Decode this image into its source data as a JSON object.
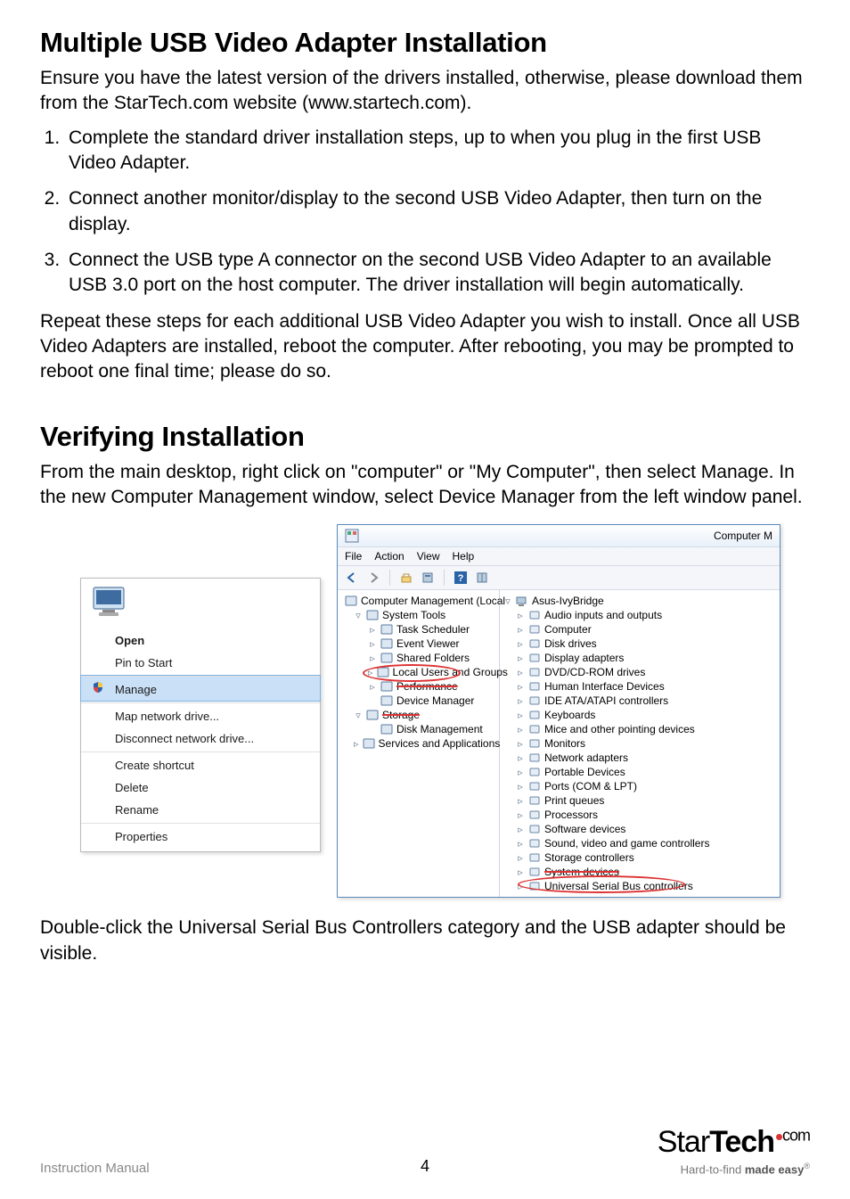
{
  "title1": "Multiple USB Video Adapter Installation",
  "intro1": "Ensure you have the latest version of the drivers installed, otherwise, please download them from the StarTech.com website (www.startech.com).",
  "steps": [
    "Complete the standard driver installation steps, up to when you plug in the first USB Video Adapter.",
    "Connect another monitor/display to the second USB Video Adapter, then turn on the display.",
    "Connect the USB type A connector on the second USB Video Adapter to an available USB 3.0 port on the host computer. The driver installation will begin automatically."
  ],
  "after_steps": "Repeat these steps for each additional USB Video Adapter you wish to install. Once all USB Video Adapters are installed, reboot the computer. After rebooting, you may be prompted to reboot one final time; please do so.",
  "title2": "Verifying Installation",
  "intro2": "From the main desktop, right click on \"computer\" or \"My Computer\", then select Manage. In the new Computer Management window, select Device Manager from the left window panel.",
  "context_menu": {
    "items": [
      {
        "label": "Open",
        "bold": true
      },
      {
        "label": "Pin to Start"
      },
      {
        "label": "Manage",
        "hover": true,
        "shield": true,
        "divider": true
      },
      {
        "label": "Map network drive...",
        "divider": true
      },
      {
        "label": "Disconnect network drive..."
      },
      {
        "label": "Create shortcut",
        "divider": true
      },
      {
        "label": "Delete"
      },
      {
        "label": "Rename"
      },
      {
        "label": "Properties",
        "divider": true
      }
    ]
  },
  "cm": {
    "title_right": "Computer M",
    "menu": [
      "File",
      "Action",
      "View",
      "Help"
    ],
    "left_tree": [
      {
        "label": "Computer Management (Local",
        "icon": "app",
        "indent": 0,
        "tw": ""
      },
      {
        "label": "System Tools",
        "icon": "wrench",
        "indent": 1,
        "tw": "▿"
      },
      {
        "label": "Task Scheduler",
        "icon": "clock",
        "indent": 2,
        "tw": "▹"
      },
      {
        "label": "Event Viewer",
        "icon": "event",
        "indent": 2,
        "tw": "▹"
      },
      {
        "label": "Shared Folders",
        "icon": "folder",
        "indent": 2,
        "tw": "▹"
      },
      {
        "label": "Local Users and Groups",
        "icon": "users",
        "indent": 2,
        "tw": "▹"
      },
      {
        "label": "Performance",
        "icon": "perf",
        "indent": 2,
        "tw": "▹",
        "strike": true
      },
      {
        "label": "Device Manager",
        "icon": "device",
        "indent": 2,
        "tw": "",
        "circle": true
      },
      {
        "label": "Storage",
        "icon": "storage",
        "indent": 1,
        "tw": "▿",
        "strike": true
      },
      {
        "label": "Disk Management",
        "icon": "disk",
        "indent": 2,
        "tw": ""
      },
      {
        "label": "Services and Applications",
        "icon": "services",
        "indent": 1,
        "tw": "▹"
      }
    ],
    "right_tree_root": "Asus-IvyBridge",
    "right_tree": [
      "Audio inputs and outputs",
      "Computer",
      "Disk drives",
      "Display adapters",
      "DVD/CD-ROM drives",
      "Human Interface Devices",
      "IDE ATA/ATAPI controllers",
      "Keyboards",
      "Mice and other pointing devices",
      "Monitors",
      "Network adapters",
      "Portable Devices",
      "Ports (COM & LPT)",
      "Print queues",
      "Processors",
      "Software devices",
      "Sound, video and game controllers",
      "Storage controllers",
      "System devices",
      "Universal Serial Bus controllers"
    ]
  },
  "concl": "Double-click the Universal Serial Bus Controllers category and the USB adapter should be visible.",
  "footer_left": "Instruction Manual",
  "page_no": "4",
  "logo": {
    "p1": "Star",
    "p2": "Tech",
    "com": "com"
  },
  "tagline": {
    "a": "Hard-to-find ",
    "b": "made easy"
  }
}
